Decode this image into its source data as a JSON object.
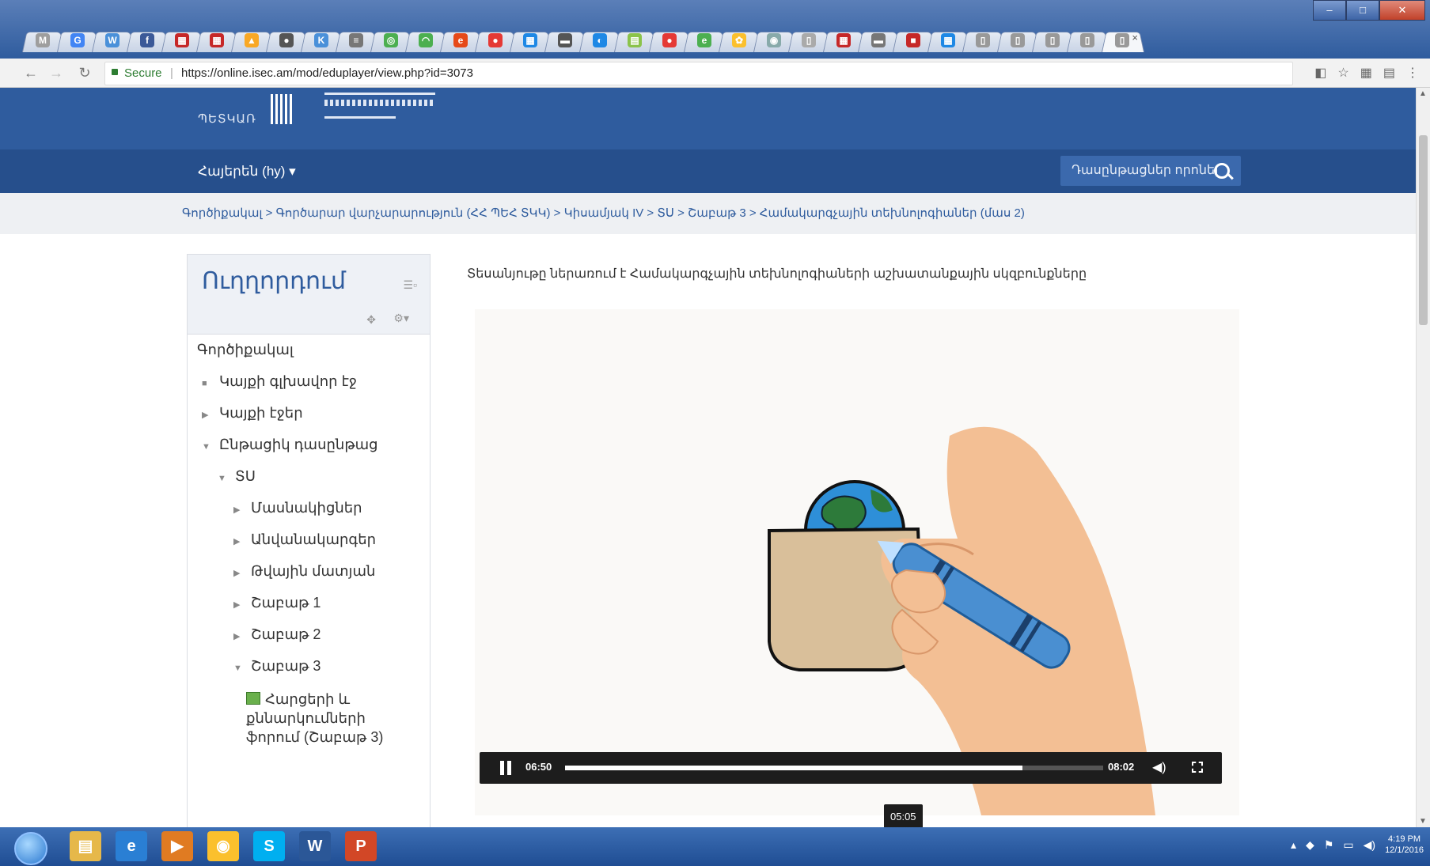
{
  "browser": {
    "tabs": [
      {
        "fav": "M",
        "color": "#9e9e9e"
      },
      {
        "fav": "G",
        "color": "#4285f4"
      },
      {
        "fav": "W",
        "color": "#4a90d9"
      },
      {
        "fav": "f",
        "color": "#3b5998"
      },
      {
        "fav": "▦",
        "color": "#c62828"
      },
      {
        "fav": "▦",
        "color": "#c62828"
      },
      {
        "fav": "▲",
        "color": "#f9a825"
      },
      {
        "fav": "●",
        "color": "#555"
      },
      {
        "fav": "K",
        "color": "#4a90d9"
      },
      {
        "fav": "≡",
        "color": "#777"
      },
      {
        "fav": "◎",
        "color": "#4caf50"
      },
      {
        "fav": "◠",
        "color": "#4caf50"
      },
      {
        "fav": "e",
        "color": "#e64a19"
      },
      {
        "fav": "●",
        "color": "#e53935"
      },
      {
        "fav": "▦",
        "color": "#1e88e5"
      },
      {
        "fav": "▬",
        "color": "#555"
      },
      {
        "fav": "◐",
        "color": "#1e88e5"
      },
      {
        "fav": "▤",
        "color": "#8bc34a"
      },
      {
        "fav": "●",
        "color": "#e53935"
      },
      {
        "fav": "e",
        "color": "#4caf50"
      },
      {
        "fav": "✿",
        "color": "#fbc02d"
      },
      {
        "fav": "◉",
        "color": "#8aa"
      },
      {
        "fav": "▯",
        "color": "#aaa"
      },
      {
        "fav": "▦",
        "color": "#c62828"
      },
      {
        "fav": "▬",
        "color": "#777"
      },
      {
        "fav": "■",
        "color": "#c62828"
      },
      {
        "fav": "▦",
        "color": "#1e88e5"
      },
      {
        "fav": "▯",
        "color": "#999"
      },
      {
        "fav": "▯",
        "color": "#999"
      },
      {
        "fav": "▯",
        "color": "#999"
      },
      {
        "fav": "▯",
        "color": "#999"
      },
      {
        "fav": "▯",
        "color": "#999"
      }
    ],
    "active_tab_close": "×",
    "secure_label": "Secure",
    "url": "https://online.isec.am/mod/eduplayer/view.php?id=3073"
  },
  "site": {
    "language_menu": "Հայերեն (hy) ▾",
    "search_placeholder": "Դասընթացներ որոնել",
    "breadcrumb": "Գործիքակալ > Գործարար վարչարարություն (ՀՀ ՊԵՀ ՏԿԿ) > Կիսամյակ IV > ՏՍ > Շաբաթ 3 > Համակարգչային տեխնոլոգիաներ (մաս 2)"
  },
  "sidebar": {
    "title": "Ուղղորդում",
    "items": [
      {
        "label": "Գործիքակալ",
        "level": 0,
        "arrow": ""
      },
      {
        "label": "Կայքի գլխավոր էջ",
        "level": 1,
        "arrow": "■"
      },
      {
        "label": "Կայքի էջեր",
        "level": 1,
        "arrow": "▶"
      },
      {
        "label": "Ընթացիկ դասընթաց",
        "level": 1,
        "arrow": "▼"
      },
      {
        "label": "ՏՍ",
        "level": 2,
        "arrow": "▼"
      },
      {
        "label": "Մասնակիցներ",
        "level": 3,
        "arrow": "▶"
      },
      {
        "label": "Անվանակարգեր",
        "level": 3,
        "arrow": "▶"
      },
      {
        "label": "Թվային մատյան",
        "level": 3,
        "arrow": "▶"
      },
      {
        "label": "Շաբաթ 1",
        "level": 3,
        "arrow": "▶"
      },
      {
        "label": "Շաբաթ 2",
        "level": 3,
        "arrow": "▶"
      },
      {
        "label": "Շաբաթ 3",
        "level": 3,
        "arrow": "▼"
      },
      {
        "label": "Հարցերի և քննարկումների ֆորում (Շաբաթ 3)",
        "level": 4,
        "arrow": ""
      }
    ]
  },
  "main": {
    "intro": "Տեսանյութը ներառում է Համակարգչային տեխնոլոգիաների աշխատանքային սկզբունքները"
  },
  "player": {
    "current_time": "06:50",
    "duration": "08:02",
    "progress": 0.85,
    "hover_time": "05:05"
  },
  "taskbar": {
    "apps": [
      {
        "label": "▤",
        "color": "#e6b84a"
      },
      {
        "label": "e",
        "color": "#2a7fd4"
      },
      {
        "label": "▶",
        "color": "#e07b22"
      },
      {
        "label": "◉",
        "color": "#fbc02d"
      },
      {
        "label": "S",
        "color": "#00aff0"
      },
      {
        "label": "W",
        "color": "#2b5797"
      },
      {
        "label": "P",
        "color": "#d24726"
      }
    ],
    "clock_time": "4:19 PM",
    "clock_date": "12/1/2016"
  },
  "colors": {
    "header": "#2f5c9e",
    "navbar": "#264f8c",
    "link": "#2f5c9e",
    "crayon": "#4a8fd1"
  }
}
